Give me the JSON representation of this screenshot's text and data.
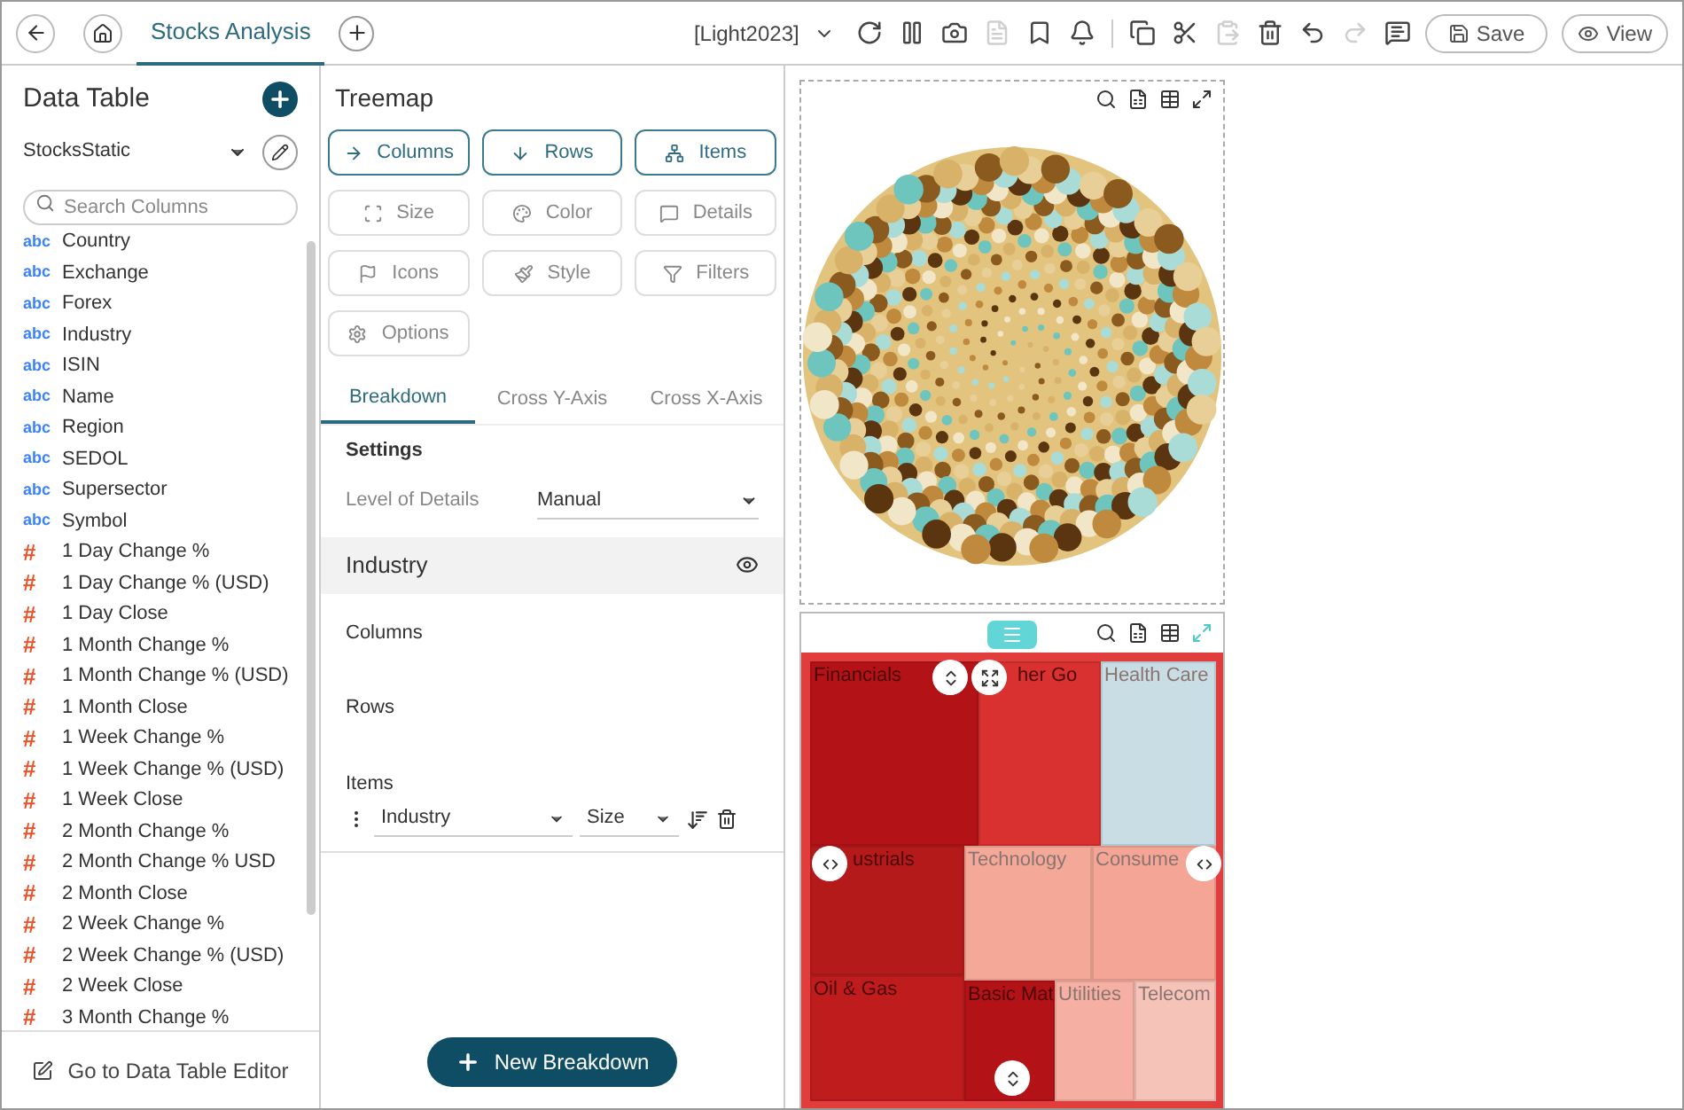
{
  "top_bar": {
    "tab": {
      "label": "Stocks Analysis",
      "selected": true
    },
    "theme": "[Light2023]",
    "tools": [
      {
        "kind": "refresh",
        "disabled": false
      },
      {
        "kind": "pause",
        "disabled": false
      },
      {
        "kind": "snapshot",
        "disabled": false
      },
      {
        "kind": "pdf",
        "disabled": true
      },
      {
        "kind": "bookmark",
        "disabled": false
      },
      {
        "kind": "bell",
        "disabled": false
      },
      {
        "kind": "copy",
        "disabled": false
      },
      {
        "kind": "cut",
        "disabled": false
      },
      {
        "kind": "paste",
        "disabled": true
      },
      {
        "kind": "delete",
        "disabled": false
      },
      {
        "kind": "undo",
        "disabled": false
      },
      {
        "kind": "redo",
        "disabled": true
      },
      {
        "kind": "comment",
        "disabled": false
      }
    ],
    "save": "Save",
    "view": "View"
  },
  "data_table": {
    "title": "Data Table",
    "source": "StocksStatic",
    "search": {
      "placeholder": "Search Columns"
    },
    "columns": [
      {
        "kind": "text",
        "tag": "abc",
        "name": "Country"
      },
      {
        "kind": "text",
        "tag": "abc",
        "name": "Exchange"
      },
      {
        "kind": "text",
        "tag": "abc",
        "name": "Forex"
      },
      {
        "kind": "text",
        "tag": "abc",
        "name": "Industry"
      },
      {
        "kind": "text",
        "tag": "abc",
        "name": "ISIN"
      },
      {
        "kind": "text",
        "tag": "abc",
        "name": "Name"
      },
      {
        "kind": "text",
        "tag": "abc",
        "name": "Region"
      },
      {
        "kind": "text",
        "tag": "abc",
        "name": "SEDOL"
      },
      {
        "kind": "text",
        "tag": "abc",
        "name": "Supersector"
      },
      {
        "kind": "text",
        "tag": "abc",
        "name": "Symbol"
      },
      {
        "kind": "number",
        "tag": "#",
        "name": "1 Day Change %"
      },
      {
        "kind": "number",
        "tag": "#",
        "name": "1 Day Change % (USD)"
      },
      {
        "kind": "number",
        "tag": "#",
        "name": "1 Day Close"
      },
      {
        "kind": "number",
        "tag": "#",
        "name": "1 Month Change %"
      },
      {
        "kind": "number",
        "tag": "#",
        "name": "1 Month Change % (USD)"
      },
      {
        "kind": "number",
        "tag": "#",
        "name": "1 Month Close"
      },
      {
        "kind": "number",
        "tag": "#",
        "name": "1 Week Change %"
      },
      {
        "kind": "number",
        "tag": "#",
        "name": "1 Week Change % (USD)"
      },
      {
        "kind": "number",
        "tag": "#",
        "name": "1 Week Close"
      },
      {
        "kind": "number",
        "tag": "#",
        "name": "2 Month Change %"
      },
      {
        "kind": "number",
        "tag": "#",
        "name": "2 Month Change % USD"
      },
      {
        "kind": "number",
        "tag": "#",
        "name": "2 Month Close"
      },
      {
        "kind": "number",
        "tag": "#",
        "name": "2 Week Change %"
      },
      {
        "kind": "number",
        "tag": "#",
        "name": "2 Week Change % (USD)"
      },
      {
        "kind": "number",
        "tag": "#",
        "name": "2 Week Close"
      },
      {
        "kind": "number",
        "tag": "#",
        "name": "3 Month Change %"
      }
    ],
    "editor_link": "Go to Data Table Editor"
  },
  "settings_panel": {
    "title": "Treemap",
    "buttons": [
      {
        "kind": "columns",
        "label": "Columns",
        "highlighted": true
      },
      {
        "kind": "rows",
        "label": "Rows",
        "highlighted": true
      },
      {
        "kind": "items",
        "label": "Items",
        "highlighted": true
      },
      {
        "kind": "size",
        "label": "Size",
        "highlighted": false
      },
      {
        "kind": "color",
        "label": "Color",
        "highlighted": false
      },
      {
        "kind": "details",
        "label": "Details",
        "highlighted": false
      },
      {
        "kind": "icons",
        "label": "Icons",
        "highlighted": false
      },
      {
        "kind": "style",
        "label": "Style",
        "highlighted": false
      },
      {
        "kind": "filters",
        "label": "Filters",
        "highlighted": false
      },
      {
        "kind": "options",
        "label": "Options",
        "highlighted": false
      }
    ],
    "tabs": [
      {
        "label": "Breakdown",
        "selected": true
      },
      {
        "label": "Cross Y-Axis",
        "selected": false
      },
      {
        "label": "Cross X-Axis",
        "selected": false
      }
    ],
    "settings_heading": "Settings",
    "level_of_details": {
      "label": "Level of Details",
      "value": "Manual"
    },
    "breakdown": {
      "title": "Industry",
      "columns_label": "Columns",
      "rows_label": "Rows",
      "items_label": "Items",
      "item": {
        "field": "Industry",
        "measure": "Size"
      }
    },
    "new_breakdown": "New Breakdown"
  },
  "treemap": {
    "tiles": [
      {
        "label": "Financials",
        "color": "#b31217"
      },
      {
        "label": "her Go",
        "color": "#d93030"
      },
      {
        "label": "Health Care",
        "color": "#c9dde5"
      },
      {
        "label": "ustrials",
        "color": "#b51a1a"
      },
      {
        "label": "Technology",
        "color": "#f4a898"
      },
      {
        "label": "Consume",
        "color": "#f4a595"
      },
      {
        "label": "Oil & Gas",
        "color": "#bf1d1d"
      },
      {
        "label": "Basic Mat",
        "color": "#b31217"
      },
      {
        "label": "Utilities",
        "color": "#f5b0a3"
      },
      {
        "label": "Telecom",
        "color": "#f6c3b9"
      }
    ]
  }
}
